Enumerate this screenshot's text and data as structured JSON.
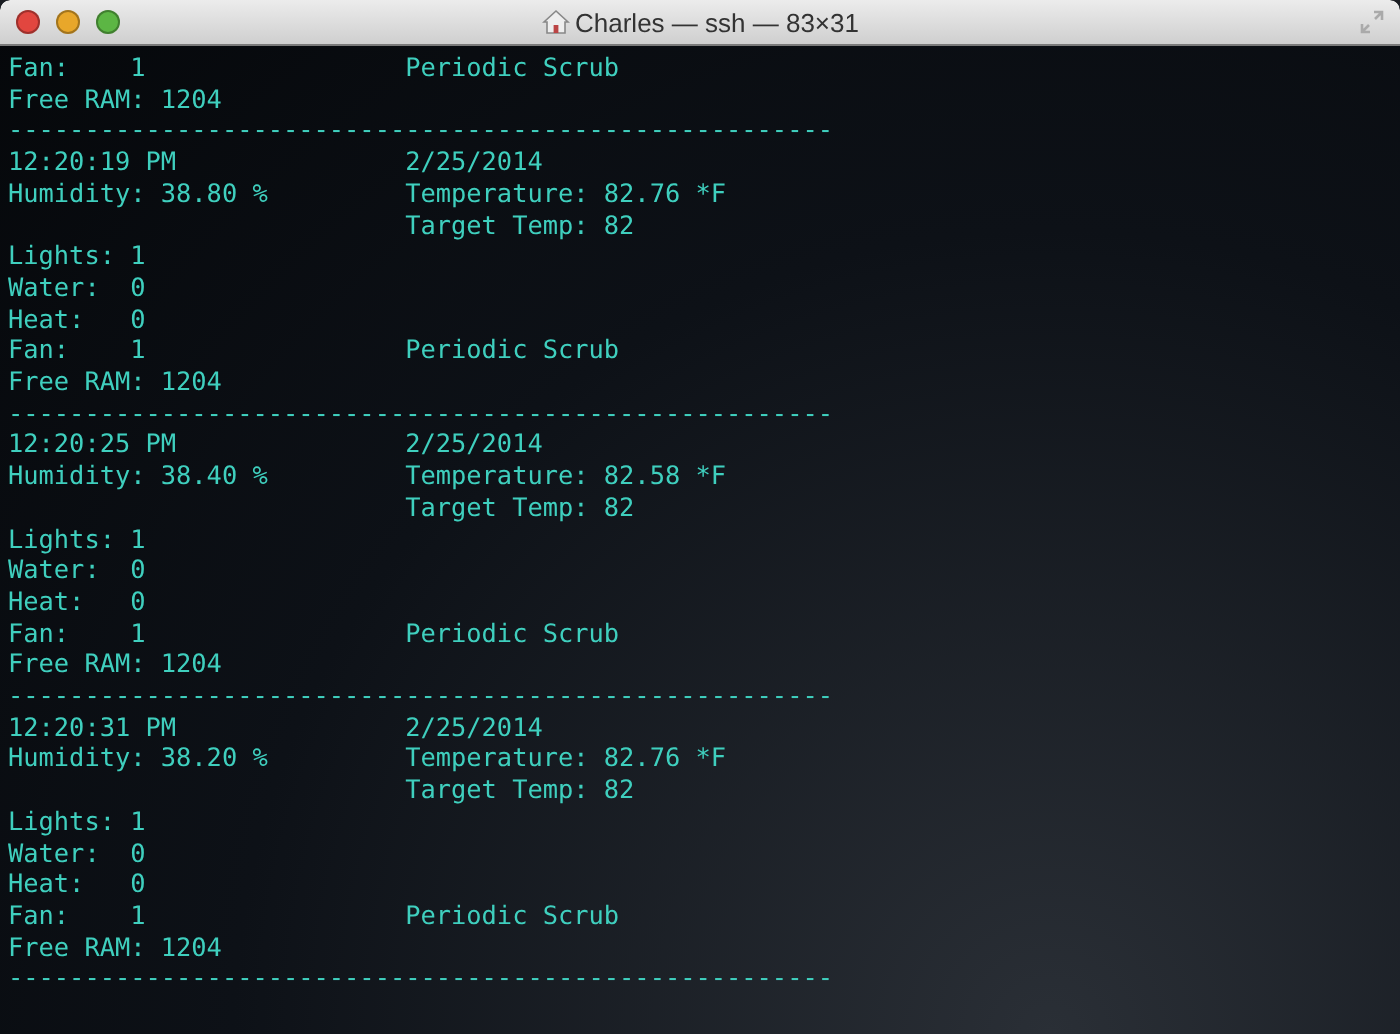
{
  "window": {
    "title": "Charles — ssh — 83×31"
  },
  "terminal": {
    "lines": [
      "Fan:    1                 Periodic Scrub",
      "Free RAM: 1204",
      "------------------------------------------------------",
      "12:20:19 PM               2/25/2014",
      "Humidity: 38.80 %         Temperature: 82.76 *F",
      "                          Target Temp: 82",
      "Lights: 1",
      "Water:  0",
      "Heat:   0",
      "Fan:    1                 Periodic Scrub",
      "Free RAM: 1204",
      "------------------------------------------------------",
      "12:20:25 PM               2/25/2014",
      "Humidity: 38.40 %         Temperature: 82.58 *F",
      "                          Target Temp: 82",
      "Lights: 1",
      "Water:  0",
      "Heat:   0",
      "Fan:    1                 Periodic Scrub",
      "Free RAM: 1204",
      "------------------------------------------------------",
      "12:20:31 PM               2/25/2014",
      "Humidity: 38.20 %         Temperature: 82.76 *F",
      "                          Target Temp: 82",
      "Lights: 1",
      "Water:  0",
      "Heat:   0",
      "Fan:    1                 Periodic Scrub",
      "Free RAM: 1204",
      "------------------------------------------------------"
    ]
  }
}
